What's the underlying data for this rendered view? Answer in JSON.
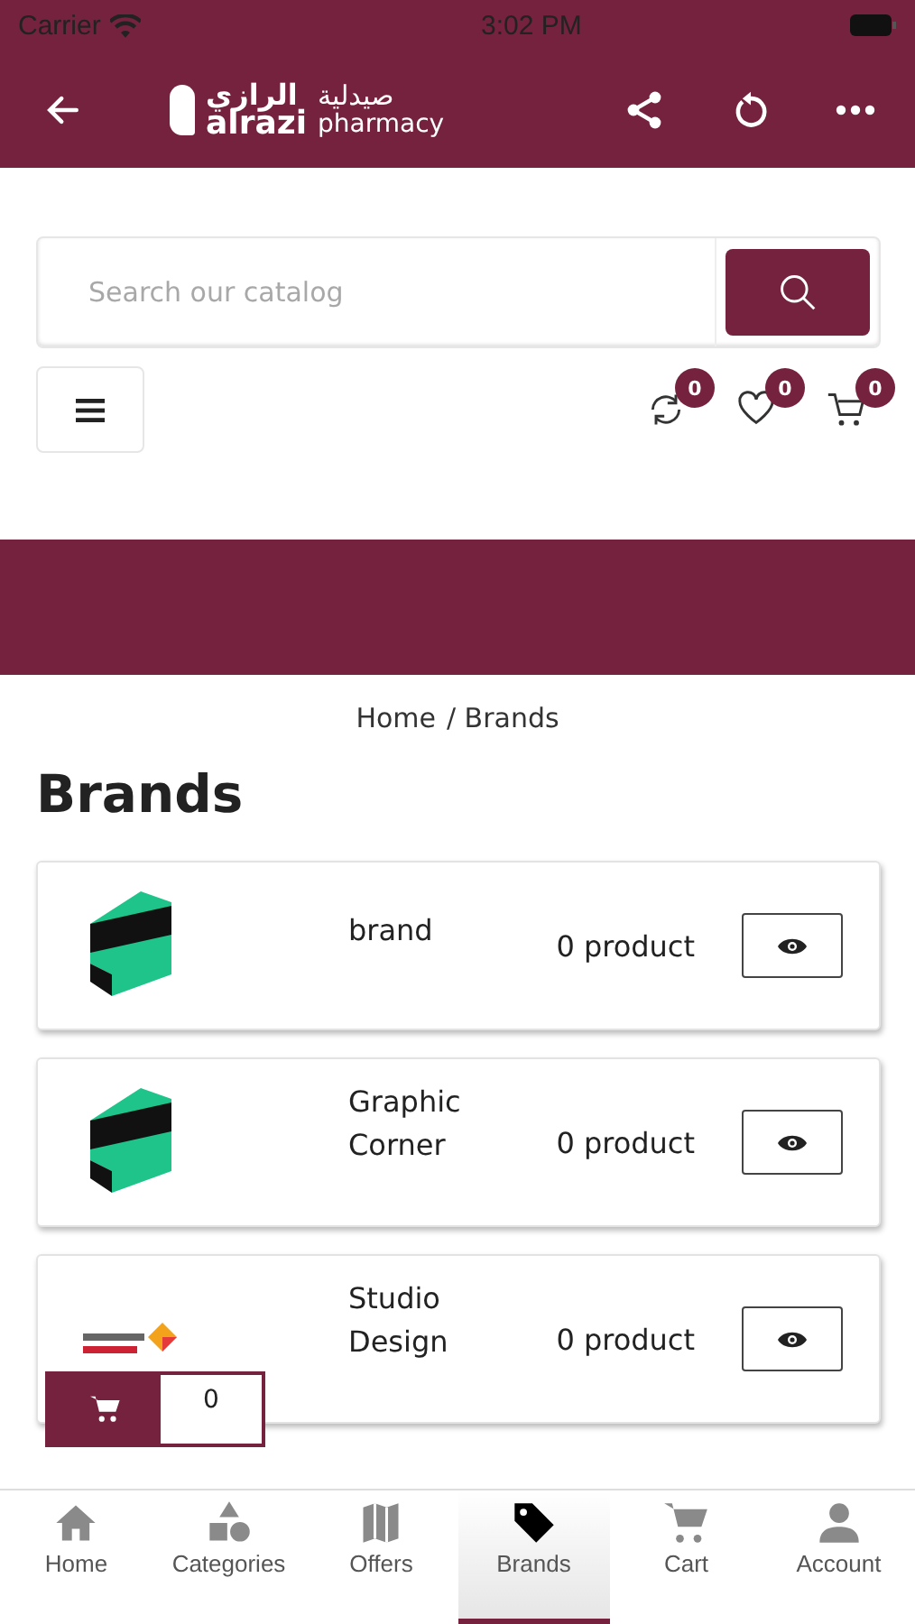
{
  "status_bar": {
    "carrier": "Carrier",
    "time": "3:02 PM"
  },
  "header": {
    "logo": {
      "name_ar": "الرازي",
      "name_en": "alrazi",
      "subtitle_ar": "صيدلية",
      "subtitle_en": "pharmacy"
    }
  },
  "search": {
    "placeholder": "Search our catalog"
  },
  "counters": [
    {
      "kind": "compare",
      "count": "0"
    },
    {
      "kind": "wishlist",
      "count": "0"
    },
    {
      "kind": "cart",
      "count": "0"
    }
  ],
  "breadcrumb": [
    "Home",
    "/ Brands"
  ],
  "page_title": "Brands",
  "brands": [
    {
      "name": "brand",
      "products": "0 product",
      "kind": "ribbon"
    },
    {
      "name": "Graphic Corner",
      "products": "0 product",
      "kind": "ribbon"
    },
    {
      "name": "Studio Design",
      "products": "0 product",
      "kind": "studio"
    }
  ],
  "floating_cart": {
    "count": "0"
  },
  "tabs": [
    {
      "label": "Home",
      "kind": "home",
      "selected": false
    },
    {
      "label": "Categories",
      "kind": "shapes",
      "selected": false
    },
    {
      "label": "Offers",
      "kind": "map",
      "selected": false
    },
    {
      "label": "Brands",
      "kind": "tag",
      "selected": true
    },
    {
      "label": "Cart",
      "kind": "cart",
      "selected": false
    },
    {
      "label": "Account",
      "kind": "person",
      "selected": false
    }
  ]
}
